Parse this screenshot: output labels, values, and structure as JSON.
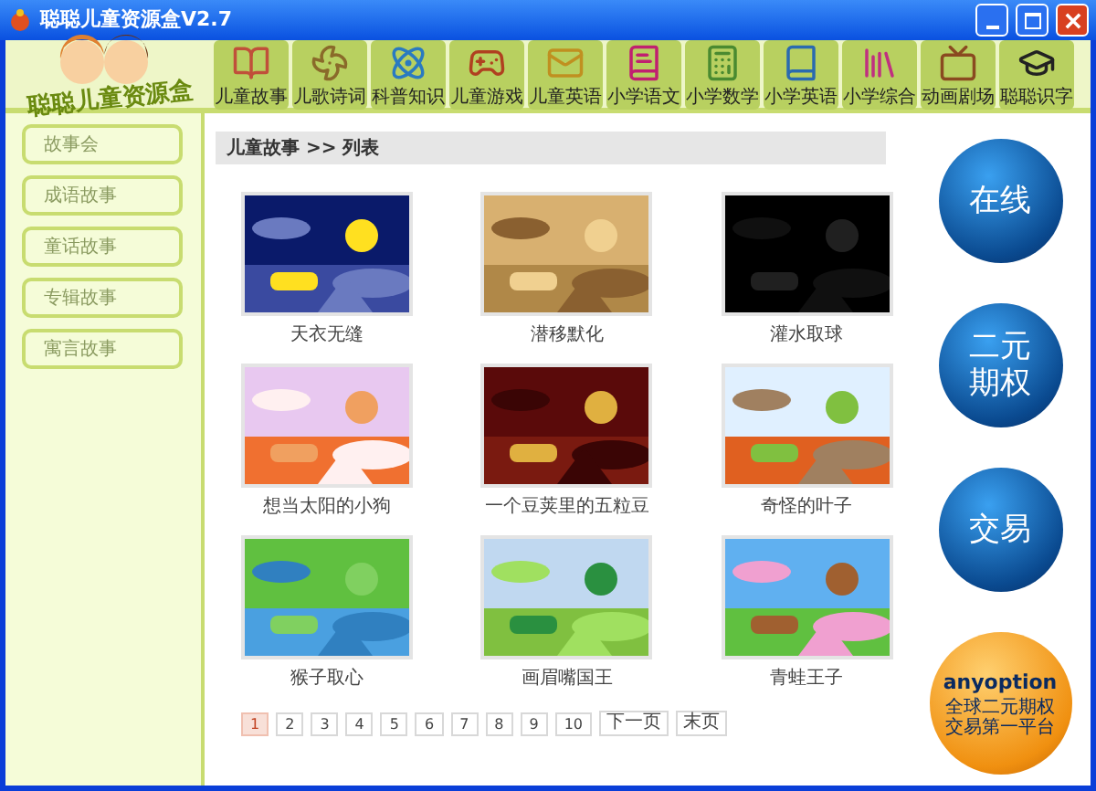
{
  "window": {
    "title": "聪聪儿童资源盒V2.7"
  },
  "toolbar": {
    "logo": "聪聪儿童资源盒",
    "items": [
      {
        "label": "儿童故事"
      },
      {
        "label": "儿歌诗词"
      },
      {
        "label": "科普知识"
      },
      {
        "label": "儿童游戏"
      },
      {
        "label": "儿童英语"
      },
      {
        "label": "小学语文"
      },
      {
        "label": "小学数学"
      },
      {
        "label": "小学英语"
      },
      {
        "label": "小学综合"
      },
      {
        "label": "动画剧场"
      },
      {
        "label": "聪聪识字"
      }
    ]
  },
  "sidebar": {
    "items": [
      "故事会",
      "成语故事",
      "童话故事",
      "专辑故事",
      "寓言故事"
    ]
  },
  "breadcrumb": "儿童故事 >> 列表",
  "stories": [
    {
      "caption": "天衣无缝"
    },
    {
      "caption": "潜移默化"
    },
    {
      "caption": "灌水取球"
    },
    {
      "caption": "想当太阳的小狗"
    },
    {
      "caption": "一个豆荚里的五粒豆"
    },
    {
      "caption": "奇怪的叶子"
    },
    {
      "caption": "猴子取心"
    },
    {
      "caption": "画眉嘴国王"
    },
    {
      "caption": "青蛙王子"
    }
  ],
  "pagination": {
    "pages": [
      {
        "label": "1",
        "selected": true
      },
      {
        "label": "2",
        "selected": false
      },
      {
        "label": "3",
        "selected": false
      },
      {
        "label": "4",
        "selected": false
      },
      {
        "label": "5",
        "selected": false
      },
      {
        "label": "6",
        "selected": false
      },
      {
        "label": "7",
        "selected": false
      },
      {
        "label": "8",
        "selected": false
      },
      {
        "label": "9",
        "selected": false
      },
      {
        "label": "10",
        "selected": false
      }
    ],
    "next": "下一页",
    "last": "末页"
  },
  "ads": {
    "buttons": [
      "在线",
      "二元期权",
      "交易"
    ],
    "brand": "anyoption",
    "slogan": "全球二元期权交易第一平台"
  }
}
